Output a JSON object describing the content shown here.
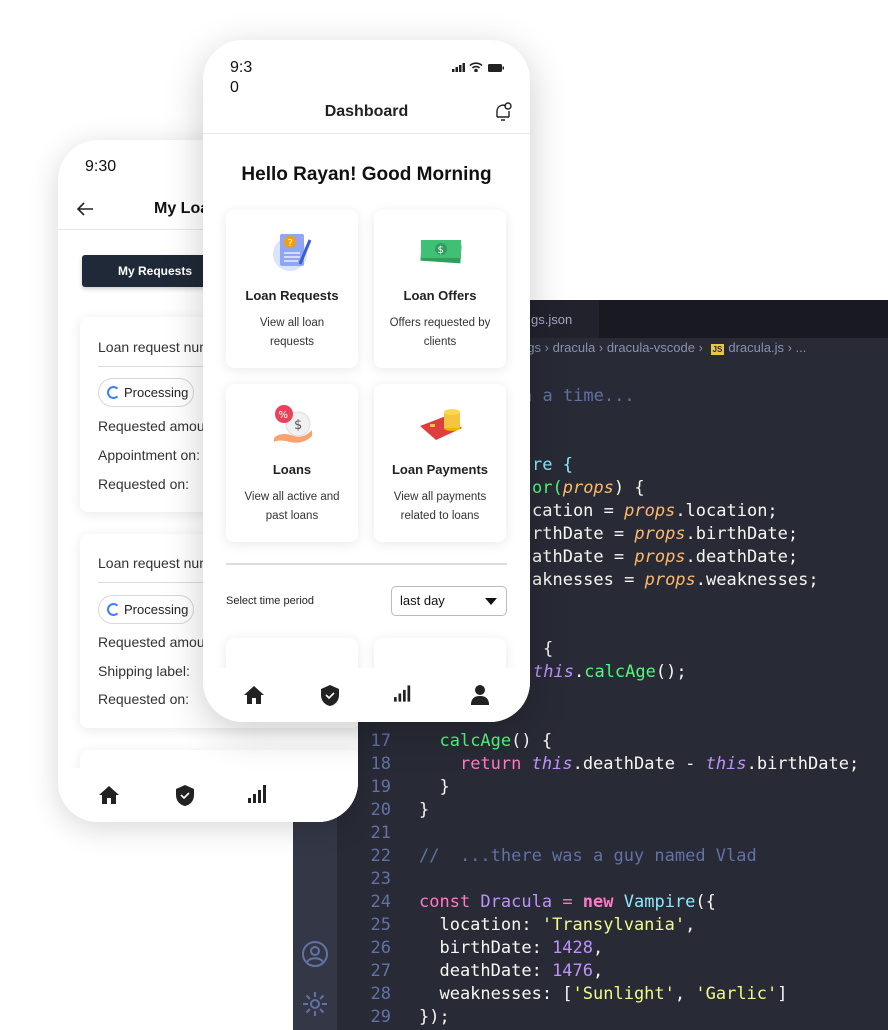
{
  "editor": {
    "tab_label": "gs.json",
    "breadcrumb": [
      "rgs",
      "dracula",
      "dracula-vscode",
      "dracula.js",
      "..."
    ],
    "breadcrumb_file_badge": "JS",
    "line_numbers": [
      "17",
      "18",
      "19",
      "20",
      "21",
      "22",
      "23",
      "24",
      "25",
      "26",
      "27",
      "28",
      "29"
    ],
    "code": {
      "l2": "n a time...",
      "l5": "re {",
      "l6a": "or(",
      "l6b": "props",
      "l6c": ") {",
      "l7a": "cation = ",
      "l7b": "props",
      "l7c": ".location;",
      "l8a": "rthDate = ",
      "l8b": "props",
      "l8c": ".birthDate;",
      "l9a": "athDate = ",
      "l9b": "props",
      "l9c": ".deathDate;",
      "l10a": "aknesses = ",
      "l10b": "props",
      "l10c": ".weaknesses;",
      "l13": "{",
      "l14a": "this",
      "l14b": ".",
      "l14c": "calcAge",
      "l14d": "();",
      "l17a": "  ",
      "l17b": "calcAge",
      "l17c": "() {",
      "l18a": "    ",
      "l18b": "return",
      "l18c": " ",
      "l18d": "this",
      "l18e": ".deathDate - ",
      "l18f": "this",
      "l18g": ".birthDate;",
      "l19": "  }",
      "l20": "}",
      "l22": "//  ...there was a guy named Vlad",
      "l24a": "const",
      "l24b": " Dracula ",
      "l24c": "=",
      "l24d": " new ",
      "l24e": "Vampire",
      "l24f": "({",
      "l25a": "  location: ",
      "l25b": "'Transylvania'",
      "l25c": ",",
      "l26a": "  birthDate: ",
      "l26b": "1428",
      "l26c": ",",
      "l27a": "  deathDate: ",
      "l27b": "1476",
      "l27c": ",",
      "l28a": "  weaknesses: [",
      "l28b": "'Sunlight'",
      "l28c": ", ",
      "l28d": "'Garlic'",
      "l28e": "]",
      "l29": "});"
    }
  },
  "back_phone": {
    "time": "9:30",
    "title": "My Loa",
    "tab_active": "My Requests",
    "cards": [
      {
        "header": "Loan request num",
        "status": "Processing",
        "rows": [
          "Requested amour",
          "Appointment on:",
          "Requested on:"
        ]
      },
      {
        "header": "Loan request num",
        "status": "Processing",
        "rows": [
          "Requested amour",
          "Shipping label:",
          "Requested on:"
        ]
      }
    ]
  },
  "front_phone": {
    "time": "9:3\n0",
    "title": "Dashboard",
    "greeting": "Hello Rayan! Good Morning",
    "tiles": [
      {
        "title": "Loan Requests",
        "desc": "View all loan requests"
      },
      {
        "title": "Loan Offers",
        "desc": "Offers requested by clients"
      },
      {
        "title": "Loans",
        "desc": "View all active and past loans"
      },
      {
        "title": "Loan Payments",
        "desc": "View all payments related to loans"
      }
    ],
    "period_label": "Select time period",
    "period_value": "last day"
  },
  "colors": {
    "editor_bg": "#282a36",
    "pink": "#ff79c6",
    "green": "#50fa7b",
    "cyan": "#8be9fd",
    "orange": "#ffb86c",
    "purple": "#bd93f9",
    "yellow": "#f1fa8c",
    "comment": "#6272a4",
    "button_dark": "#1f2937"
  },
  "icons": [
    "back-arrow-icon",
    "refresh-icon",
    "home-icon",
    "shield-check-icon",
    "signal-icon",
    "user-icon",
    "bell-icon",
    "wifi-icon",
    "battery-icon",
    "account-icon",
    "settings-icon"
  ]
}
